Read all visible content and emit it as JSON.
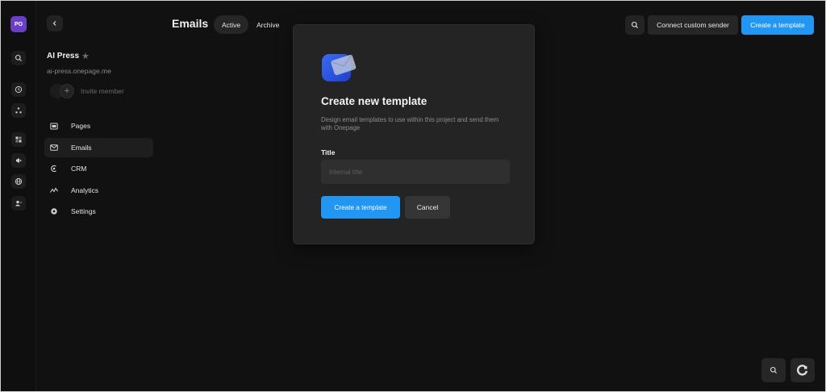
{
  "rail": {
    "avatar_initials": "PO"
  },
  "sidebar": {
    "project_name": "AI Press",
    "project_url": "ai-press.onepage.me",
    "invite_label": "Invite member",
    "items": [
      {
        "label": "Pages",
        "icon": "pages-icon"
      },
      {
        "label": "Emails",
        "icon": "mail-icon",
        "active": true
      },
      {
        "label": "CRM",
        "icon": "crm-icon"
      },
      {
        "label": "Analytics",
        "icon": "analytics-icon"
      },
      {
        "label": "Settings",
        "icon": "settings-icon"
      }
    ]
  },
  "header": {
    "title": "Emails",
    "tabs": [
      {
        "label": "Active",
        "active": true
      },
      {
        "label": "Archive",
        "active": false
      }
    ],
    "connect_label": "Connect custom sender",
    "create_label": "Create a template"
  },
  "modal": {
    "title": "Create new template",
    "description": "Design email templates to use within this project and send them with Onepage",
    "field_label": "Title",
    "field_placeholder": "Internal title",
    "field_value": "",
    "primary_label": "Create a template",
    "cancel_label": "Cancel"
  },
  "colors": {
    "accent": "#2196f3",
    "avatar": "#6a3ec6",
    "background": "#111111",
    "modal": "#242424"
  }
}
